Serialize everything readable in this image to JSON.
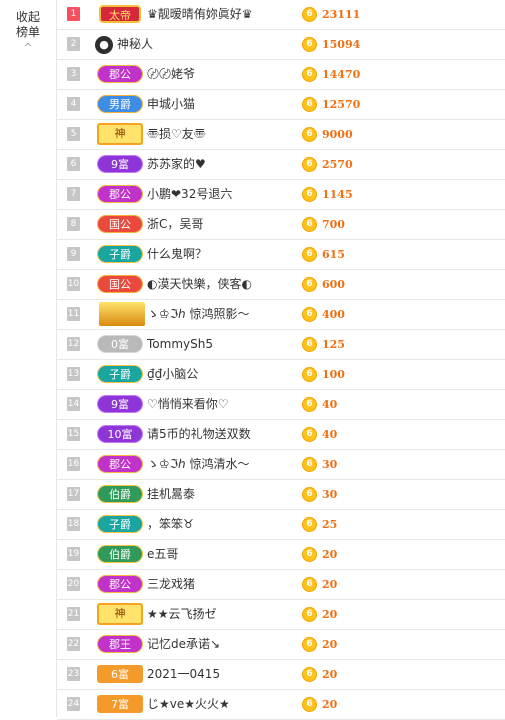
{
  "sidebar": {
    "collapse_label": "收起榜单",
    "collapse_icon": "chevron-up-icon"
  },
  "coin_symbol": "6",
  "rows": [
    {
      "rank": "1",
      "badge": "太帝",
      "badge_style": "b-emperor",
      "name": "♛靓暧晴侑妳眞好♛",
      "score": "23111"
    },
    {
      "rank": "2",
      "badge": "",
      "badge_style": "avatar",
      "name": "神秘人",
      "score": "15094"
    },
    {
      "rank": "3",
      "badge": "郡公",
      "badge_style": "b-pink",
      "name": "〄〄姥爷",
      "score": "14470"
    },
    {
      "rank": "4",
      "badge": "男爵",
      "badge_style": "b-blue",
      "name": "申城小猫",
      "score": "12570"
    },
    {
      "rank": "5",
      "badge": "神",
      "badge_style": "b-shen",
      "name": "〠损♡友〠",
      "score": "9000"
    },
    {
      "rank": "6",
      "badge": "9富",
      "badge_style": "b-purple",
      "name": "苏苏家的♥",
      "score": "2570"
    },
    {
      "rank": "7",
      "badge": "郡公",
      "badge_style": "b-pink",
      "name": "小鹏❤32号退六",
      "score": "1145"
    },
    {
      "rank": "8",
      "badge": "国公",
      "badge_style": "b-red",
      "name": "浙C，吴哥",
      "score": "700"
    },
    {
      "rank": "9",
      "badge": "子爵",
      "badge_style": "b-teal",
      "name": "什么鬼啊？",
      "score": "615"
    },
    {
      "rank": "10",
      "badge": "国公",
      "badge_style": "b-red",
      "name": "◐漠天快樂，侠客◐",
      "score": "600"
    },
    {
      "rank": "11",
      "badge": "",
      "badge_style": "b-crown",
      "name": "ゝ♔ℑℎ 惊鸿照影～",
      "score": "400"
    },
    {
      "rank": "12",
      "badge": "0富",
      "badge_style": "b-gray",
      "name": "TommySh5",
      "score": "125"
    },
    {
      "rank": "13",
      "badge": "子爵",
      "badge_style": "b-teal",
      "name": "₫₫小脑公",
      "score": "100"
    },
    {
      "rank": "14",
      "badge": "9富",
      "badge_style": "b-purple",
      "name": "♡悄悄来看你♡",
      "score": "40"
    },
    {
      "rank": "15",
      "badge": "10富",
      "badge_style": "b-purple",
      "name": "请5币的礼物送双数",
      "score": "40"
    },
    {
      "rank": "16",
      "badge": "郡公",
      "badge_style": "b-pink",
      "name": "ゝ♔ℑℎ 惊鸿清水～",
      "score": "30"
    },
    {
      "rank": "17",
      "badge": "伯爵",
      "badge_style": "b-green",
      "name": "挂机暠泰",
      "score": "30"
    },
    {
      "rank": "18",
      "badge": "子爵",
      "badge_style": "b-teal",
      "name": "，笨笨♉",
      "score": "25"
    },
    {
      "rank": "19",
      "badge": "伯爵",
      "badge_style": "b-green",
      "name": "e五哥",
      "score": "20"
    },
    {
      "rank": "20",
      "badge": "郡公",
      "badge_style": "b-pink",
      "name": "三龙戏猪",
      "score": "20"
    },
    {
      "rank": "21",
      "badge": "神",
      "badge_style": "b-shen",
      "name": "★★云飞扬ゼ",
      "score": "20"
    },
    {
      "rank": "22",
      "badge": "郡王",
      "badge_style": "b-pink",
      "name": "记忆de承诺↘",
      "score": "20"
    },
    {
      "rank": "23",
      "badge": "6富",
      "badge_style": "b-orange",
      "name": "2021一0415",
      "score": "20"
    },
    {
      "rank": "24",
      "badge": "7富",
      "badge_style": "b-orange",
      "name": "じ★ve★火火★",
      "score": "20"
    }
  ]
}
